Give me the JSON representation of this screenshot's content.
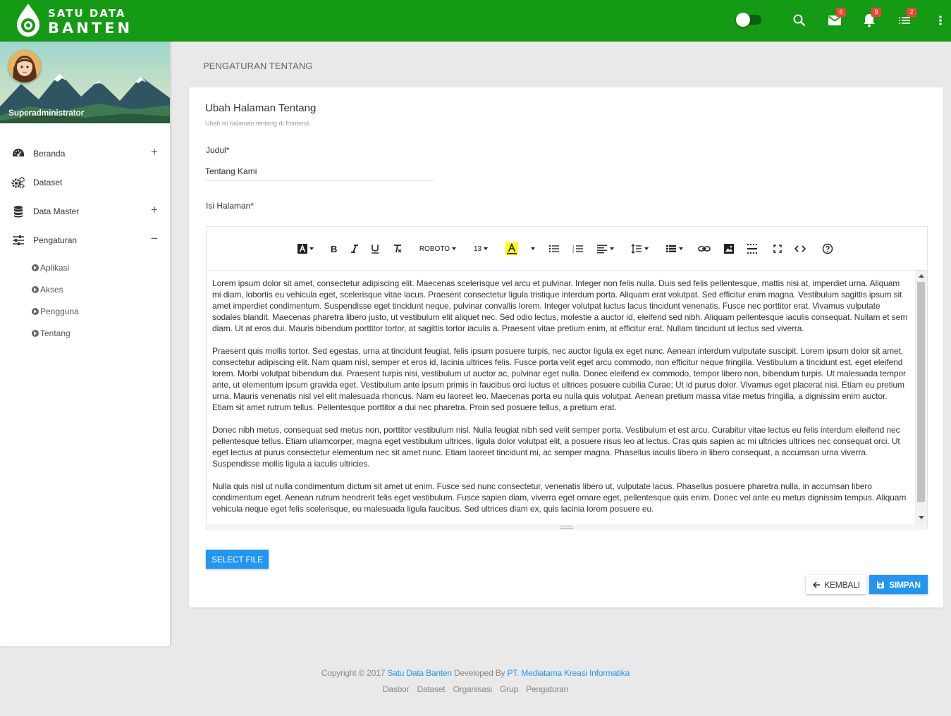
{
  "app": {
    "logo_line1": "SATU DATA",
    "logo_line2": "BANTEN",
    "brand_color": "#149a14",
    "accent_color": "#2196f3"
  },
  "topbar": {
    "search_icon": "search-icon",
    "mail_badge": "6",
    "notification_badge": "9",
    "tasks_badge": "2"
  },
  "sidebar": {
    "user_name": "Superadministrator",
    "menu": [
      {
        "label": "Beranda",
        "icon": "dashboard-icon",
        "sign": "+"
      },
      {
        "label": "Dataset",
        "icon": "gears-icon",
        "sign": ""
      },
      {
        "label": "Data Master",
        "icon": "database-icon",
        "sign": "+"
      },
      {
        "label": "Pengaturan",
        "icon": "sliders-icon",
        "sign": "−"
      }
    ],
    "submenu": [
      "Aplikasi",
      "Akses",
      "Pengguna",
      "Tentang"
    ]
  },
  "page": {
    "title": "PENGATURAN TENTANG"
  },
  "form": {
    "title": "Ubah Halaman Tentang",
    "subtitle": "Ubah isi halaman tentang di frontend.",
    "judul_label": "Judul*",
    "judul_value": "Tentang Kami",
    "isi_label": "Isi Halaman*",
    "font_name": "ROBOTO",
    "font_size": "13",
    "highlight_color": "#ffff00",
    "content": [
      "Lorem ipsum dolor sit amet, consectetur adipiscing elit. Maecenas scelerisque vel arcu et pulvinar. Integer non felis nulla. Duis sed felis pellentesque, mattis nisi at, imperdiet urna. Aliquam mi diam, lobortis eu vehicula eget, scelerisque vitae lacus. Praesent consectetur ligula tristique interdum porta. Aliquam erat volutpat. Sed efficitur enim magna. Vestibulum sagittis ipsum sit amet imperdiet condimentum. Suspendisse eget tincidunt neque, pulvinar convallis lorem. Integer volutpat luctus lacus tincidunt venenatis. Fusce nec porttitor erat. Vivamus vulputate sodales blandit. Maecenas pharetra libero justo, ut vestibulum elit aliquet nec. Sed odio lectus, molestie a auctor id, eleifend sed nibh. Aliquam pellentesque iaculis consequat. Nullam et sem diam. Ut at eros dui. Mauris bibendum porttitor tortor, at sagittis tortor iaculis a. Praesent vitae pretium enim, at efficitur erat. Nullam tincidunt ut lectus sed viverra.",
      "Praesent quis mollis tortor. Sed egestas, urna at tincidunt feugiat, felis ipsum posuere turpis, nec auctor ligula ex eget nunc. Aenean interdum vulputate suscipit. Lorem ipsum dolor sit amet, consectetur adipiscing elit. Nam quam nisl, semper et eros id, lacinia ultrices felis. Fusce porta velit eget arcu commodo, non efficitur neque fringilla. Vestibulum a tincidunt est, eget eleifend lorem. Morbi volutpat bibendum dui. Praesent turpis nisi, vestibulum ut auctor ac, pulvinar eget nulla. Donec eleifend ex commodo, tempor libero non, bibendum turpis. Ut malesuada tempor ante, ut elementum ipsum gravida eget. Vestibulum ante ipsum primis in faucibus orci luctus et ultrices posuere cubilia Curae; Ut id purus dolor. Vivamus eget placerat nisi. Etiam eu pretium urna. Mauris venenatis nisl vel elit malesuada rhoncus. Nam eu laoreet leo. Maecenas porta eu nulla quis volutpat. Aenean pretium massa vitae metus fringilla, a dignissim enim auctor. Etiam sit amet rutrum tellus. Pellentesque porttitor a dui nec pharetra. Proin sed posuere tellus, a pretium erat.",
      "Donec nibh metus, consequat sed metus non, porttitor vestibulum nisl. Nulla feugiat nibh sed velit semper porta. Vestibulum et est arcu. Curabitur vitae lectus eu felis interdum eleifend nec pellentesque tellus. Etiam ullamcorper, magna eget vestibulum ultrices, ligula dolor volutpat elit, a posuere risus leo at lectus. Cras quis sapien ac mi ultricies ultrices nec consequat orci. Ut eget lectus at purus consectetur elementum nec sit amet nunc. Etiam laoreet tincidunt mi, ac semper magna. Phasellus iaculis libero in libero consequat, a accumsan urna viverra. Suspendisse mollis ligula a iaculis ultricies.",
      "Nulla quis nisl ut nulla condimentum dictum sit amet ut enim. Fusce sed nunc consectetur, venenatis libero ut, vulputate lacus. Phasellus posuere pharetra nulla, in accumsan libero condimentum eget. Aenean rutrum hendrerit felis eget vestibulum. Fusce sapien diam, viverra eget ornare eget, pellentesque quis enim. Donec vel ante eu metus dignissim tempus. Aliquam vehicula neque eget felis scelerisque, eu malesuada ligula faucibus. Sed ultrices diam ex, quis lacinia lorem posuere eu."
    ],
    "select_file_label": "SELECT FILE",
    "back_label": "KEMBALI",
    "save_label": "SIMPAN"
  },
  "footer": {
    "copyright_prefix": "Copyright © 2017",
    "site_name": "Satu Data Banten",
    "developed_by": "Developed By",
    "developer": "PT. Mediatama Kreasi Informatika",
    "links": [
      "Dasbor",
      "Dataset",
      "Organisasi",
      "Grup",
      "Pengaturan"
    ]
  }
}
